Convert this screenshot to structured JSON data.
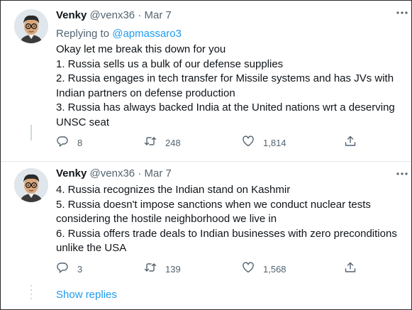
{
  "tweets": [
    {
      "author_name": "Venky",
      "handle": "@venx36",
      "separator": "·",
      "date": "Mar 7",
      "replying_prefix": "Replying to ",
      "replying_to": "@apmassaro3",
      "lines": [
        "Okay let me break this down for you",
        "1. Russia sells us a bulk of our defense supplies",
        "2. Russia engages in tech transfer for Missile systems and has JVs with",
        "Indian partners on defense production",
        "3. Russia has always backed India at the United nations wrt a deserving",
        "UNSC seat"
      ],
      "replies": "8",
      "retweets": "248",
      "likes": "1,814"
    },
    {
      "author_name": "Venky",
      "handle": "@venx36",
      "separator": "·",
      "date": "Mar 7",
      "lines": [
        "4. Russia recognizes the Indian stand on Kashmir",
        "5. Russia doesn't impose sanctions when we conduct nuclear tests",
        "considering the hostile neighborhood we live in",
        "6. Russia offers trade deals to Indian businesses with zero preconditions",
        "unlike the USA"
      ],
      "replies": "3",
      "retweets": "139",
      "likes": "1,568"
    }
  ],
  "show_replies": "Show replies",
  "icons": {
    "reply": "reply-icon",
    "retweet": "retweet-icon",
    "like": "heart-icon",
    "share": "share-icon",
    "more": "more-icon"
  },
  "colors": {
    "link": "#1d9bf0",
    "secondary_text": "#536471",
    "primary_text": "#0f1419",
    "divider": "#e4e8eb"
  }
}
